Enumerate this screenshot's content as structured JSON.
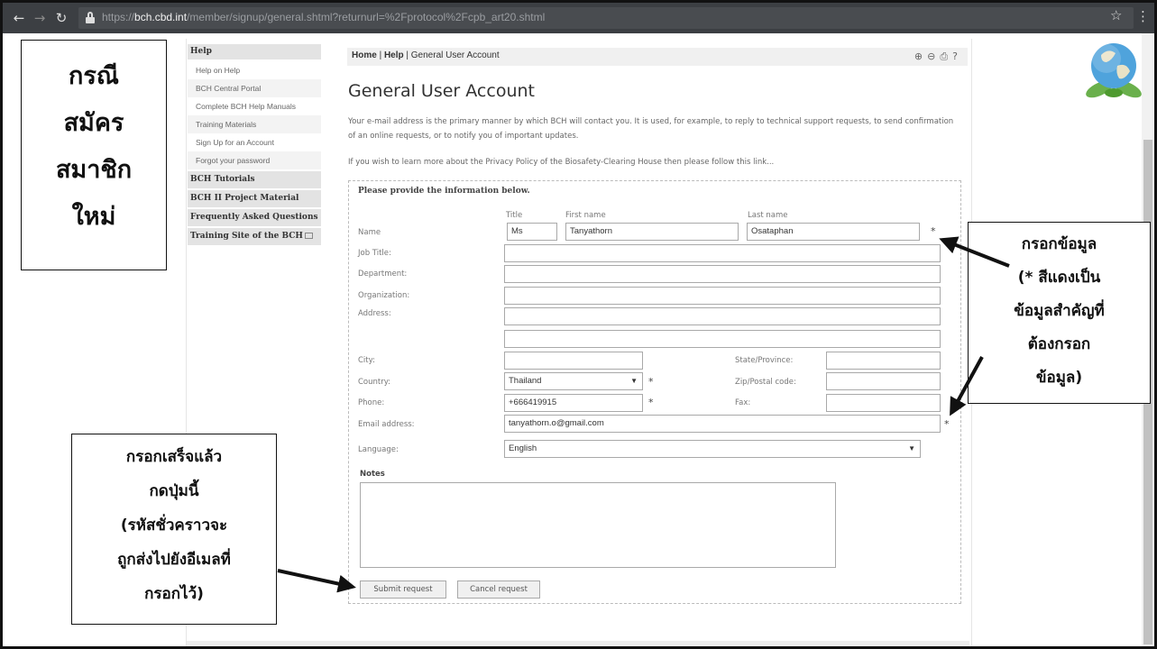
{
  "browser": {
    "url_scheme": "https://",
    "url_host": "bch.cbd.int",
    "url_path": "/member/signup/general.shtml?returnurl=%2Fprotocol%2Fcpb_art20.shtml"
  },
  "sidebar": {
    "help_heading": "Help",
    "help_items": [
      "Help on Help",
      "BCH Central Portal",
      "Complete BCH Help Manuals",
      "Training Materials",
      "Sign Up for an Account",
      "Forgot your password"
    ],
    "sections": [
      "BCH Tutorials",
      "BCH II Project Material",
      "Frequently Asked Questions",
      "Training Site of the BCH"
    ]
  },
  "breadcrumb": {
    "home": "Home",
    "help": "Help",
    "current": "General User Account"
  },
  "page": {
    "title": "General User Account",
    "intro": "Your e-mail address is the primary manner by which BCH will contact you. It is used, for example, to reply to technical support requests, to send confirmation of an online requests, or to notify you of important updates.",
    "privacy": "If you wish to learn more about the Privacy Policy of the Biosafety-Clearing House then please follow this link..."
  },
  "form": {
    "heading": "Please provide the information below.",
    "col_title": "Title",
    "col_first": "First name",
    "col_last": "Last name",
    "labels": {
      "name": "Name",
      "job_title": "Job Title:",
      "department": "Department:",
      "organization": "Organization:",
      "address": "Address:",
      "city": "City:",
      "country": "Country:",
      "phone": "Phone:",
      "email": "Email address:",
      "language": "Language:",
      "state": "State/Province:",
      "zip": "Zip/Postal code:",
      "fax": "Fax:",
      "notes": "Notes"
    },
    "values": {
      "title": "Ms",
      "first_name": "Tanyathorn",
      "last_name": "Osataphan",
      "country": "Thailand",
      "phone": "+666419915",
      "email": "tanyathorn.o@gmail.com",
      "language": "English"
    },
    "required_mark": "*",
    "submit_label": "Submit request",
    "cancel_label": "Cancel request"
  },
  "overlays": {
    "title_lines": [
      "กรณี",
      "สมัคร",
      "สมาชิก",
      "ใหม่"
    ],
    "fill_lines": [
      "กรอกข้อมูล",
      "(* สีแดงเป็น",
      "ข้อมูลสำคัญที่",
      "ต้องกรอก",
      "ข้อมูล)"
    ],
    "submit_lines": [
      "กรอกเสร็จแล้ว",
      "กดปุ่มนี้",
      "(รหัสชั่วคราวจะ",
      "ถูกส่งไปยังอีเมลที่",
      "กรอกไว้)"
    ]
  },
  "colors": {
    "chrome": "#3c3f43",
    "urlbar": "#494c50",
    "sidebar_head": "#e3e3e3",
    "overlay_text": "#111111"
  }
}
